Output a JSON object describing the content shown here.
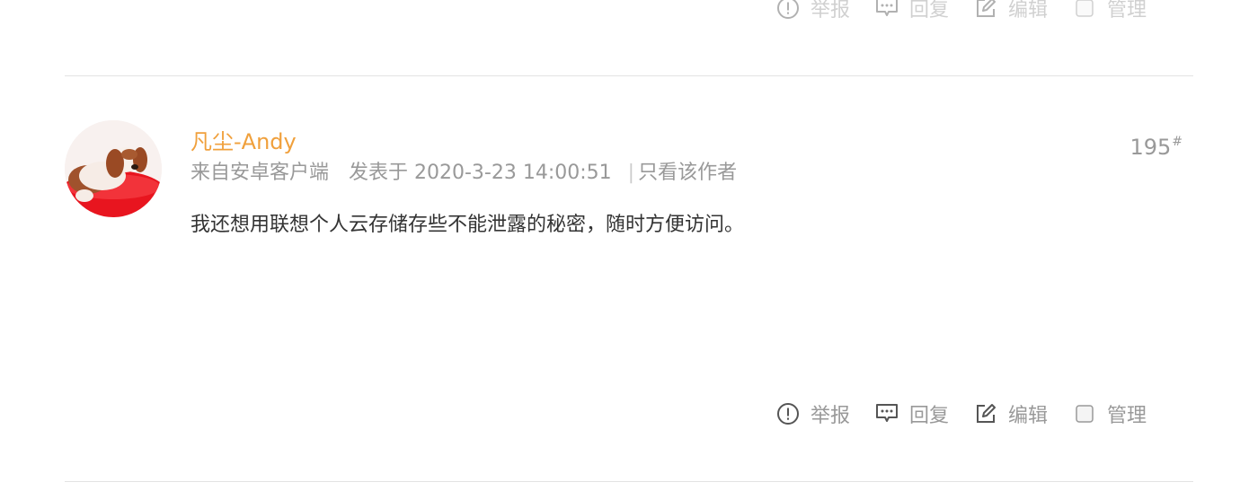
{
  "prev_post": {
    "actions": {
      "report": "举报",
      "reply": "回复",
      "edit": "编辑",
      "manage": "管理"
    }
  },
  "post": {
    "author": "凡尘-Andy",
    "source": "来自安卓客户端",
    "posted_at": "发表于 2020-3-23 14:00:51",
    "separator": "|",
    "only_author": "只看该作者",
    "floor_number": "195",
    "floor_suffix": "#",
    "content": "我还想用联想个人云存储存些不能泄露的秘密，随时方便访问。",
    "actions": {
      "report": "举报",
      "reply": "回复",
      "edit": "编辑",
      "manage": "管理"
    }
  },
  "colors": {
    "author": "#f0a03c",
    "meta": "#999999",
    "content": "#333333",
    "divider": "#e3e3e3"
  }
}
